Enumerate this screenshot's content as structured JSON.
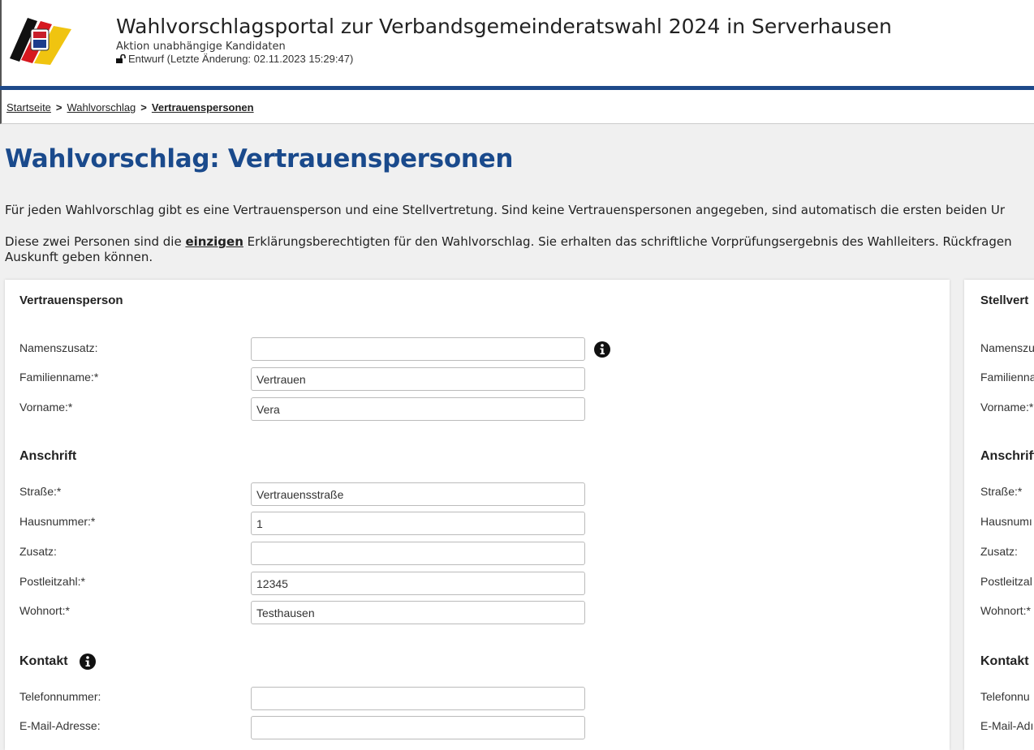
{
  "header": {
    "title": "Wahlvorschlagsportal zur Verbandsgemeinderatswahl 2024 in Serverhausen",
    "organization": "Aktion unabhängige Kandidaten",
    "status": "Entwurf (Letzte Änderung: 02.11.2023 15:29:47)"
  },
  "breadcrumb": {
    "home": "Startseite",
    "proposal": "Wahlvorschlag",
    "current": "Vertrauenspersonen",
    "separator": ">"
  },
  "page": {
    "title": "Wahlvorschlag: Vertrauenspersonen",
    "intro1": "Für jeden Wahlvorschlag gibt es eine Vertrauensperson und eine Stellvertretung. Sind keine Vertrauenspersonen angegeben, sind automatisch die ersten beiden Ur",
    "intro2_before": "Diese zwei Personen sind die ",
    "intro2_bold": "einzigen",
    "intro2_after": " Erklärungsberechtigten für den Wahlvorschlag. Sie erhalten das schriftliche Vorprüfungsergebnis des Wahlleiters. Rückfragen",
    "intro3": "Auskunft geben können."
  },
  "left_card": {
    "heading": "Vertrauensperson",
    "namenszusatz_label": "Namenszusatz:",
    "namenszusatz_value": "",
    "familienname_label": "Familienname:*",
    "familienname_value": "Vertrauen",
    "vorname_label": "Vorname:*",
    "vorname_value": "Vera",
    "anschrift_heading": "Anschrift",
    "strasse_label": "Straße:*",
    "strasse_value": "Vertrauensstraße",
    "hausnummer_label": "Hausnummer:*",
    "hausnummer_value": "1",
    "zusatz_label": "Zusatz:",
    "zusatz_value": "",
    "plz_label": "Postleitzahl:*",
    "plz_value": "12345",
    "wohnort_label": "Wohnort:*",
    "wohnort_value": "Testhausen",
    "kontakt_heading": "Kontakt",
    "telefon_label": "Telefonnummer:",
    "telefon_value": "",
    "email_label": "E-Mail-Adresse:",
    "email_value": ""
  },
  "right_card": {
    "heading": "Stellvert",
    "namenszusatz_label": "Namenszu",
    "familienname_label": "Familienna",
    "vorname_label": "Vorname:*",
    "anschrift_heading": "Anschrift",
    "strasse_label": "Straße:*",
    "hausnummer_label": "Hausnumı",
    "zusatz_label": "Zusatz:",
    "plz_label": "Postleitzal",
    "wohnort_label": "Wohnort:*",
    "kontakt_heading": "Kontakt",
    "telefon_label": "Telefonnu",
    "email_label": "E-Mail-Adı"
  },
  "colors": {
    "accent": "#1e4a8a",
    "title": "#1a4a8c"
  },
  "icons": [
    "logo",
    "unlock-icon",
    "info-icon"
  ]
}
